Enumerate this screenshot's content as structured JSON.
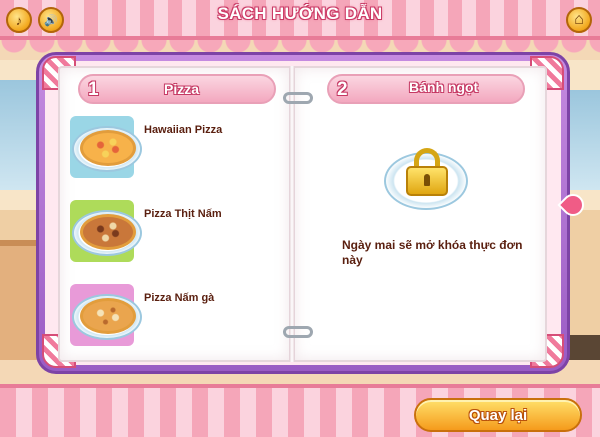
{
  "title": "SÁCH HƯỚNG DẪN",
  "toolbar": {
    "music_icon": "music-note-icon",
    "sound_icon": "speaker-icon",
    "home_icon": "home-icon",
    "music_glyph": "♪",
    "sound_glyph": "🔊",
    "home_glyph": "⌂"
  },
  "left_page": {
    "number": "1",
    "label": "Pizza",
    "recipes": [
      {
        "name": "Hawaiian Pizza",
        "thumb_color": "#9ad6e6",
        "topping_color": "#e5643a"
      },
      {
        "name": "Pizza Thịt Nấm",
        "thumb_color": "#aedb5a",
        "topping_color": "#a8582f"
      },
      {
        "name": "Pizza Nấm gà",
        "thumb_color": "#e89ad8",
        "topping_color": "#e8b05a"
      }
    ]
  },
  "right_page": {
    "number": "2",
    "label": "Bánh ngọt",
    "locked_message": "Ngày mai sẽ mở khóa thực đơn này"
  },
  "back_button": {
    "label": "Quay lại"
  },
  "colors": {
    "accent_pink": "#f05c86",
    "frame_purple": "#9a5cc4",
    "button_orange": "#f59b1c"
  }
}
